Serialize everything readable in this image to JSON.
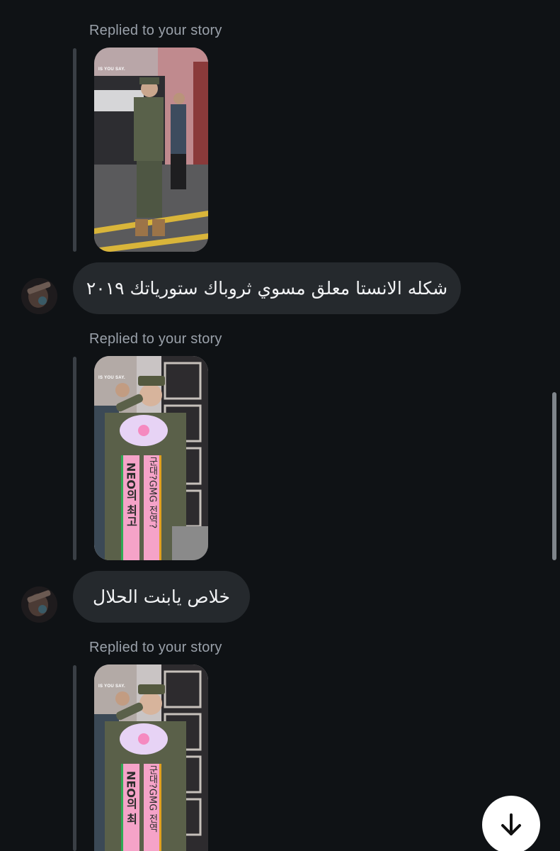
{
  "messages": [
    {
      "replied_label": "Replied to your story",
      "story_watermark": "IS YOU SAY.",
      "story_description": "soldier-salute-parking-lot"
    },
    {
      "bubble_text": "شكله الانستا معلق مسوي ثروباك ستورياتك ٢٠١٩",
      "avatar_icon": "user-avatar"
    },
    {
      "replied_label": "Replied to your story",
      "story_watermark": "IS YOU SAY.",
      "ribbon_left": "NEO의 최고",
      "ribbon_right": "군대?GMG 전역?"
    },
    {
      "bubble_text": "خلاص يابنت الحلال",
      "avatar_icon": "user-avatar"
    },
    {
      "replied_label": "Replied to your story",
      "story_watermark": "IS YOU SAY.",
      "ribbon_left": "NEO의 최",
      "ribbon_right": "군대?GMG 전역"
    }
  ],
  "scroll_down_icon": "arrow-down-icon",
  "colors": {
    "background": "#0f1215",
    "bubble": "#25292d",
    "label": "#9aa1aa",
    "reply_bar": "#3a3f45"
  }
}
